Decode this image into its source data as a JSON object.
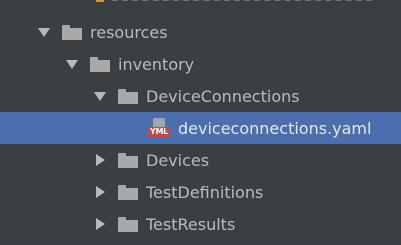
{
  "tree": {
    "items": [
      {
        "label": "resources",
        "level": 1,
        "expanded": true,
        "type": "folder",
        "icon": "folder-icon"
      },
      {
        "label": "inventory",
        "level": 2,
        "expanded": true,
        "type": "folder",
        "icon": "folder-icon"
      },
      {
        "label": "DeviceConnections",
        "level": 3,
        "expanded": true,
        "type": "folder",
        "icon": "folder-icon"
      },
      {
        "label": "deviceconnections.yaml",
        "level": 4,
        "type": "file",
        "selected": true,
        "icon": "yaml-file-icon",
        "badge": "YML"
      },
      {
        "label": "Devices",
        "level": 3,
        "expanded": false,
        "type": "folder",
        "icon": "folder-icon"
      },
      {
        "label": "TestDefinitions",
        "level": 3,
        "expanded": false,
        "type": "folder",
        "icon": "folder-icon"
      },
      {
        "label": "TestResults",
        "level": 3,
        "expanded": false,
        "type": "folder",
        "icon": "folder-icon"
      }
    ]
  },
  "colors": {
    "background": "#3c3f41",
    "selection": "#4b6eaf",
    "text": "#bbbbbb",
    "folder": "#a9a9a9",
    "yaml_badge": "#c04b4b"
  }
}
